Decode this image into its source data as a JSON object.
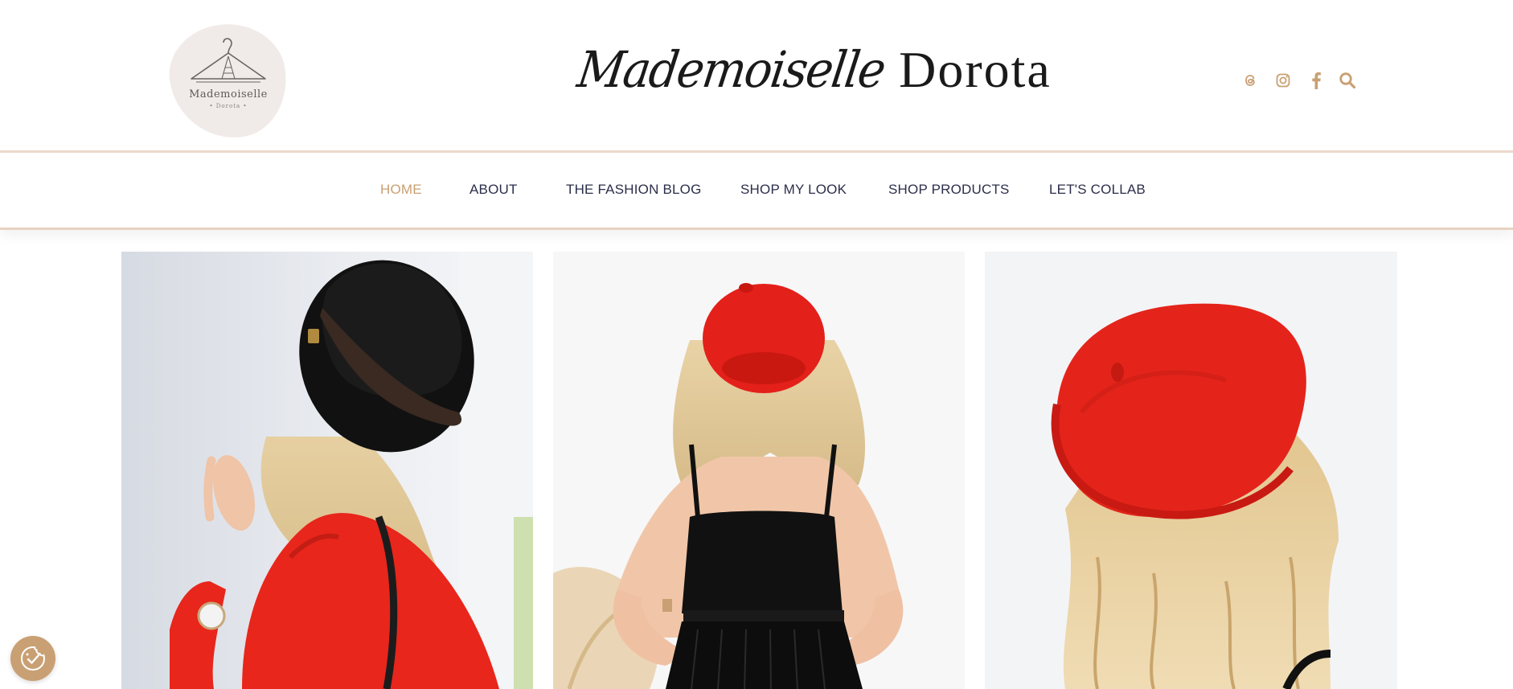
{
  "logo": {
    "name": "Mademoiselle",
    "subtitle": "• Dorota •",
    "icon": "hanger-icon"
  },
  "site_title": {
    "script": "Mademoiselle",
    "roman": "Dorota"
  },
  "social": [
    {
      "name": "threads",
      "icon": "threads-icon"
    },
    {
      "name": "instagram",
      "icon": "instagram-icon"
    },
    {
      "name": "facebook",
      "icon": "facebook-icon"
    },
    {
      "name": "search",
      "icon": "search-icon"
    }
  ],
  "nav": {
    "items": [
      {
        "label": "HOME",
        "active": true
      },
      {
        "label": "ABOUT",
        "active": false
      },
      {
        "label": "THE FASHION BLOG",
        "active": false
      },
      {
        "label": "SHOP MY LOOK",
        "active": false
      },
      {
        "label": "SHOP PRODUCTS",
        "active": false
      },
      {
        "label": "LET'S COLLAB",
        "active": false
      }
    ]
  },
  "gallery": [
    {
      "subject": "woman in black fedora and red blouse, seen from behind"
    },
    {
      "subject": "woman in red beret and black camisole, seen from behind"
    },
    {
      "subject": "close-up of red beret on blonde hair"
    }
  ],
  "cookie_button": {
    "icon": "cookie-consent-icon"
  },
  "colors": {
    "accent": "#c9a073",
    "nav_text": "#2b2f4a",
    "divider": "#ecd9cb",
    "logo_bg": "#f0ebe8",
    "red": "#e8261c"
  }
}
